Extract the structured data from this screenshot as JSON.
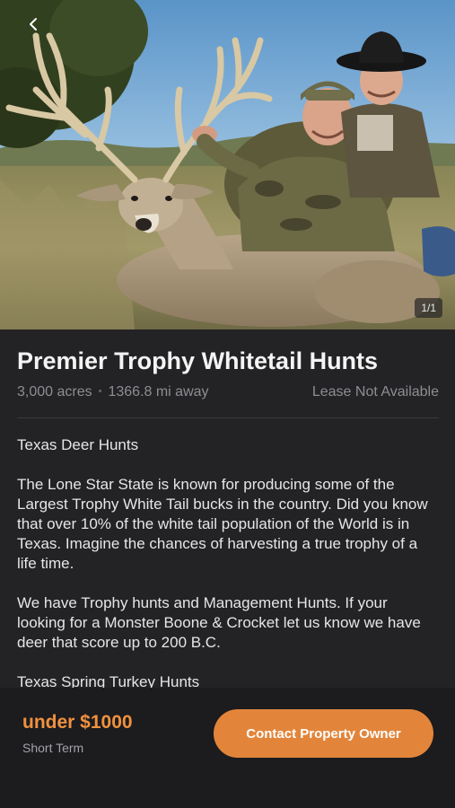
{
  "hero": {
    "image_counter": "1/1",
    "back_icon": "chevron-left-icon"
  },
  "listing": {
    "title": "Premier Trophy Whitetail Hunts",
    "acres": "3,000 acres",
    "separator": "•",
    "distance": "1366.8 mi away",
    "lease_status": "Lease Not Available",
    "description": [
      "Texas Deer Hunts",
      "The Lone Star State is known for producing some of the Largest Trophy White Tail bucks in the country. Did you know that over 10% of the white tail population of the World is in Texas. Imagine the chances of harvesting a true trophy of a life time.",
      "We have Trophy hunts and Management Hunts. If your looking for a Monster Boone & Crocket let us know we have deer that score up to 200 B.C.",
      "Texas Spring Turkey Hunts"
    ]
  },
  "footer": {
    "price": "under $1000",
    "term": "Short Term",
    "contact_label": "Contact Property Owner"
  },
  "colors": {
    "accent": "#e2853b",
    "price_text": "#f0923f",
    "background": "#232225",
    "bottom_bar": "#1c1b1e"
  }
}
